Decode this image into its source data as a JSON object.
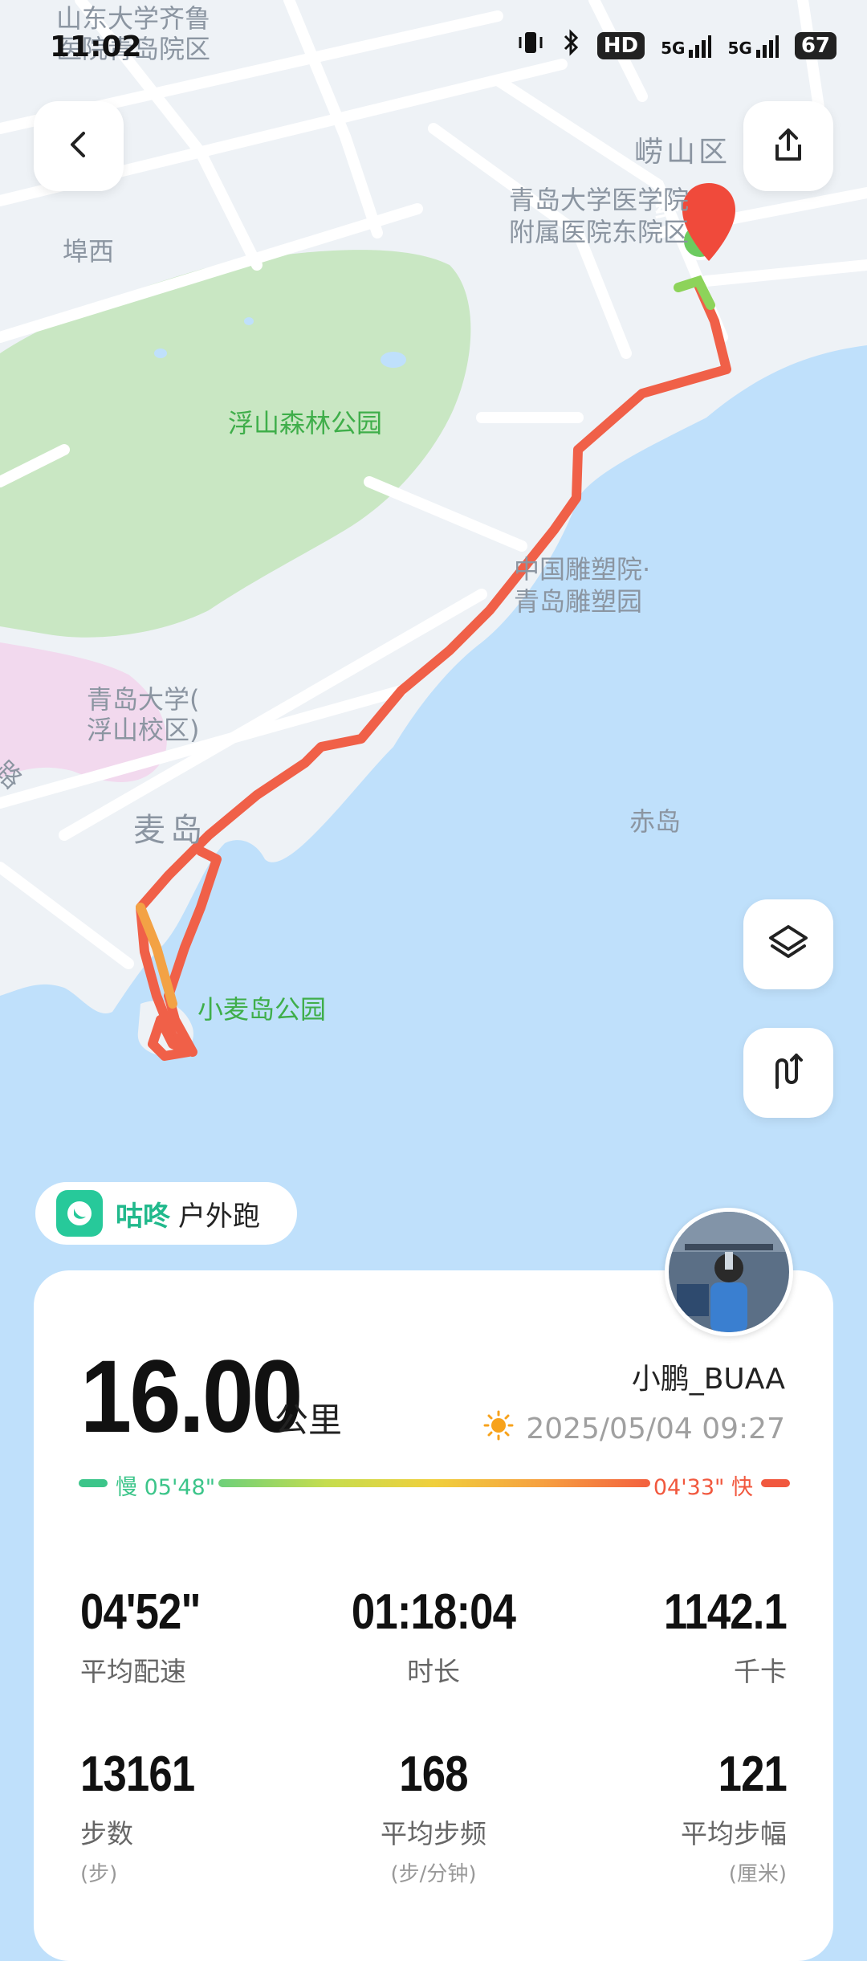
{
  "status_bar": {
    "time": "11:02",
    "network_1": "5G",
    "network_2": "5G",
    "hd": "HD",
    "battery": "67"
  },
  "map": {
    "labels": {
      "top_left_1": "山东大学齐鲁",
      "top_left_2": "医院青岛院区",
      "laoshan": "崂山区",
      "hospital_1": "青岛大学医学院",
      "hospital_2": "附属医院东院区",
      "fuxi": "埠西",
      "forest_park": "浮山森林公园",
      "sculpture_1": "中国雕塑院·",
      "sculpture_2": "青岛雕塑园",
      "university_1": "青岛大学(",
      "university_2": "浮山校区)",
      "maidao": "麦岛",
      "chidao": "赤岛",
      "xiaomaidao": "小麦岛公园",
      "road_fragment": "路"
    },
    "end_marker": "终",
    "route_colors": {
      "start": "#8dd35a",
      "mid": "#f3a245",
      "main": "#f06048"
    }
  },
  "buttons": {
    "back_icon": "chevron-left-icon",
    "share_icon": "share-icon",
    "layers_icon": "layers-icon",
    "route_icon": "route-icon"
  },
  "brand": {
    "name": "咕咚",
    "sport": "户外跑"
  },
  "summary": {
    "distance": "16.00",
    "distance_unit": "公里",
    "username": "小鹏_BUAA",
    "datetime": "2025/05/04 09:27",
    "weather_icon": "sun-icon",
    "pace_slow": "慢 05'48\"",
    "pace_fast": "04'33\" 快"
  },
  "stats": [
    {
      "value": "04'52\"",
      "label": "平均配速",
      "sub": ""
    },
    {
      "value": "01:18:04",
      "label": "时长",
      "sub": ""
    },
    {
      "value": "1142.1",
      "label": "千卡",
      "sub": ""
    },
    {
      "value": "13161",
      "label": "步数",
      "sub": "(步)"
    },
    {
      "value": "168",
      "label": "平均步频",
      "sub": "(步/分钟)"
    },
    {
      "value": "121",
      "label": "平均步幅",
      "sub": "(厘米)"
    }
  ]
}
